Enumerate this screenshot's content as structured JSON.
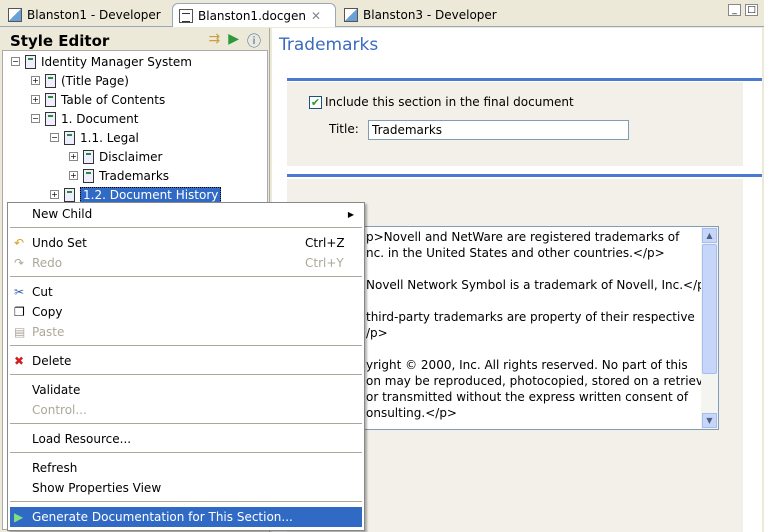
{
  "tabs": [
    {
      "label": "Blanston1 - Developer",
      "icon": "developer-icon"
    },
    {
      "label": "Blanston1.docgen",
      "icon": "document-icon",
      "active": true
    },
    {
      "label": "Blanston3 - Developer",
      "icon": "developer-icon"
    }
  ],
  "left": {
    "title": "Style Editor",
    "tree": [
      {
        "label": "Identity Manager System",
        "toggle": "−"
      },
      {
        "label": "(Title Page)",
        "toggle": "+"
      },
      {
        "label": "Table of Contents",
        "toggle": "+"
      },
      {
        "label": "1. Document",
        "toggle": "−"
      },
      {
        "label": "1.1. Legal",
        "toggle": "−"
      },
      {
        "label": "Disclaimer",
        "toggle": "+"
      },
      {
        "label": "Trademarks",
        "toggle": "+"
      },
      {
        "label": "1.2. Document History",
        "toggle": "+",
        "selected": true
      }
    ]
  },
  "right": {
    "title": "Trademarks",
    "include_label": "Include this section in the final document",
    "include_checked": true,
    "title_label": "Title:",
    "title_value": "Trademarks",
    "content_lines": [
      "p>Novell and NetWare are registered trademarks of",
      "nc. in the United States and other countries.</p>",
      "Novell Network Symbol is a trademark of Novell, Inc.</p>",
      "third-party trademarks are property of their respective",
      "/p>",
      "yright © 2000, Inc. All rights reserved. No part of this",
      "on may be reproduced, photocopied, stored on a retrieval",
      "or transmitted without the express written consent of",
      "onsulting.</p>"
    ]
  },
  "menu": {
    "new_child": "New Child",
    "undo": "Undo Set",
    "undo_sc": "Ctrl+Z",
    "redo": "Redo",
    "redo_sc": "Ctrl+Y",
    "cut": "Cut",
    "copy": "Copy",
    "paste": "Paste",
    "delete": "Delete",
    "validate": "Validate",
    "control": "Control...",
    "load": "Load Resource...",
    "refresh": "Refresh",
    "show_props": "Show Properties View",
    "generate": "Generate Documentation for This Section..."
  },
  "colors": {
    "accent": "#316ac5",
    "title": "#3a6bc0"
  }
}
